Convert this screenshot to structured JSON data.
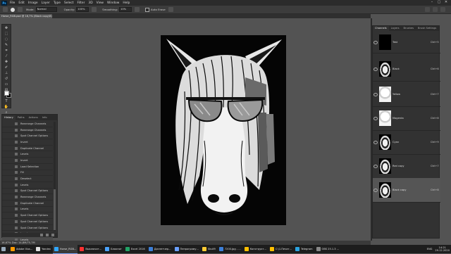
{
  "menu": {
    "items": [
      "File",
      "Edit",
      "Image",
      "Layer",
      "Type",
      "Select",
      "Filter",
      "3D",
      "View",
      "Window",
      "Help"
    ]
  },
  "options_bar": {
    "mode_label": "Mode:",
    "mode_value": "Normal",
    "opacity_label": "Opacity:",
    "opacity_value": "100%",
    "smoothing_label": "Smoothing:",
    "smoothing_value": "10%",
    "auto_erase_label": "Auto Erase"
  },
  "document": {
    "tab_title": "Horse_RGB.psd @ 16,7% (Black copy/8) *"
  },
  "history": {
    "tabs": [
      "History",
      "Paths",
      "Actions",
      "Info"
    ],
    "items": [
      "Rearrange Channels",
      "Rearrange Channels",
      "Spot Channel Options",
      "Invert",
      "Duplicate Channel",
      "Levels",
      "Invert",
      "Load Selection",
      "Fill",
      "Deselect",
      "Levels",
      "Spot Channel Options",
      "Rearrange Channels",
      "Duplicate Channel",
      "Levels",
      "Spot Channel Options",
      "Spot Channel Options",
      "Spot Channel Options",
      "Invert",
      "Levels"
    ]
  },
  "channels": {
    "tabs": [
      "Channels",
      "Layers",
      "Brushes",
      "Brush Settings"
    ],
    "rows": [
      {
        "name": "Test",
        "shortcut": "Ctrl+5",
        "thumb": "black"
      },
      {
        "name": "Black",
        "shortcut": "Ctrl+6",
        "thumb": "horse-dark"
      },
      {
        "name": "Yellow",
        "shortcut": "Ctrl+7",
        "thumb": "horse-light"
      },
      {
        "name": "Magenta",
        "shortcut": "Ctrl+8",
        "thumb": "horse-light"
      },
      {
        "name": "Cyan",
        "shortcut": "Ctrl+9",
        "thumb": "horse-dark"
      },
      {
        "name": "Red copy",
        "shortcut": "Ctrl+7",
        "thumb": "horse-dark"
      },
      {
        "name": "Black copy",
        "shortcut": "Ctrl+8",
        "thumb": "horse-dark"
      }
    ]
  },
  "status": {
    "text": "16,67%    Doc: 14,8M/75,7M"
  },
  "taskbar": {
    "items": [
      {
        "label": "Adobe Illus...",
        "color": "#ff9a00"
      },
      {
        "label": "Yandex",
        "color": "#e0e0e0"
      },
      {
        "label": "Horse_RGB...",
        "color": "#31a8ff"
      },
      {
        "label": "Выключит...",
        "color": "#ff3030"
      },
      {
        "label": "Блокнот",
        "color": "#4aa3ff"
      },
      {
        "label": "Excel 2016",
        "color": "#21a366"
      },
      {
        "label": "Диспетчер...",
        "color": "#3c7fd9"
      },
      {
        "label": "Пепрограму...",
        "color": "#6aa0ff"
      },
      {
        "label": "Skull9",
        "color": "#ffcc33"
      },
      {
        "label": "7200.jpg - ...",
        "color": "#3c7fd9"
      },
      {
        "label": "Конструкт...",
        "color": "#ffc000"
      },
      {
        "label": "C:\\1.Печат...",
        "color": "#ffc000"
      },
      {
        "label": "Telegram",
        "color": "#2aa3e0"
      },
      {
        "label": "OBS 25.1.3 ...",
        "color": "#888888"
      }
    ],
    "lang": "ENG",
    "time": "14:21",
    "date": "29.12.2020"
  }
}
